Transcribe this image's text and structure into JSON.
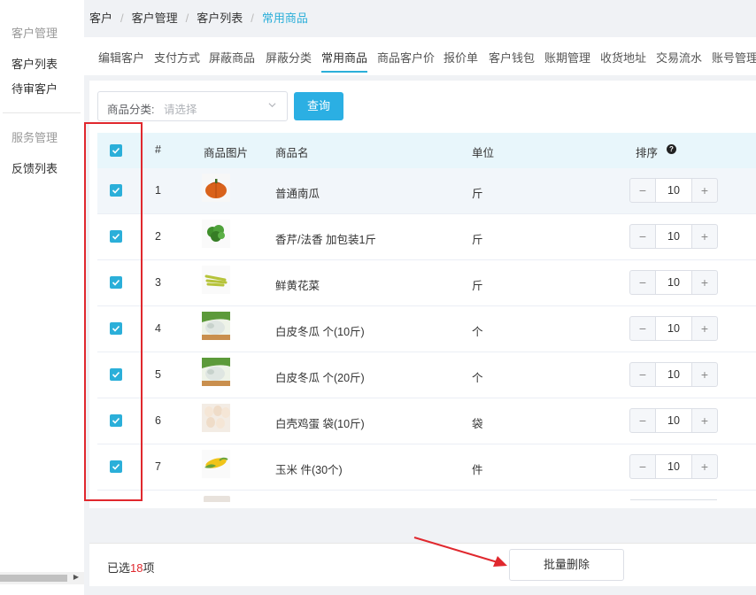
{
  "sidebar": {
    "section1": "客户管理",
    "items1": [
      "客户列表",
      "待审客户"
    ],
    "section2": "服务管理",
    "items2": [
      "反馈列表"
    ]
  },
  "breadcrumb": {
    "items": [
      "客户",
      "客户管理",
      "客户列表"
    ],
    "current": "常用商品",
    "separator": "/"
  },
  "tabs": [
    "编辑客户",
    "支付方式",
    "屏蔽商品",
    "屏蔽分类",
    "常用商品",
    "商品客户价",
    "报价单",
    "客户钱包",
    "账期管理",
    "收货地址",
    "交易流水",
    "账号管理"
  ],
  "active_tab": "常用商品",
  "filter": {
    "label": "商品分类:",
    "placeholder": "请选择",
    "query_button": "查询"
  },
  "table": {
    "headers": {
      "index": "#",
      "image": "商品图片",
      "name": "商品名",
      "unit": "单位",
      "sort": "排序",
      "sort_help_icon": "?"
    },
    "rows": [
      {
        "index": "1",
        "name": "普通南瓜",
        "unit": "斤",
        "sort": "10",
        "image": "pumpkin"
      },
      {
        "index": "2",
        "name": "香芹/法香 加包装1斤",
        "unit": "斤",
        "sort": "10",
        "image": "parsley"
      },
      {
        "index": "3",
        "name": "鲜黄花菜",
        "unit": "斤",
        "sort": "10",
        "image": "daylily"
      },
      {
        "index": "4",
        "name": "白皮冬瓜 个(10斤)",
        "unit": "个",
        "sort": "10",
        "image": "winter-melon"
      },
      {
        "index": "5",
        "name": "白皮冬瓜 个(20斤)",
        "unit": "个",
        "sort": "10",
        "image": "winter-melon"
      },
      {
        "index": "6",
        "name": "白壳鸡蛋 袋(10斤)",
        "unit": "袋",
        "sort": "10",
        "image": "eggs"
      },
      {
        "index": "7",
        "name": "玉米 件(30个)",
        "unit": "件",
        "sort": "10",
        "image": "corn"
      }
    ],
    "stepper_minus": "−",
    "stepper_plus": "+"
  },
  "footer": {
    "selected_prefix": "已选",
    "selected_count": "18",
    "selected_suffix": "项",
    "batch_delete": "批量删除"
  },
  "colors": {
    "accent": "#2bafd9",
    "highlight": "#e0282e"
  }
}
